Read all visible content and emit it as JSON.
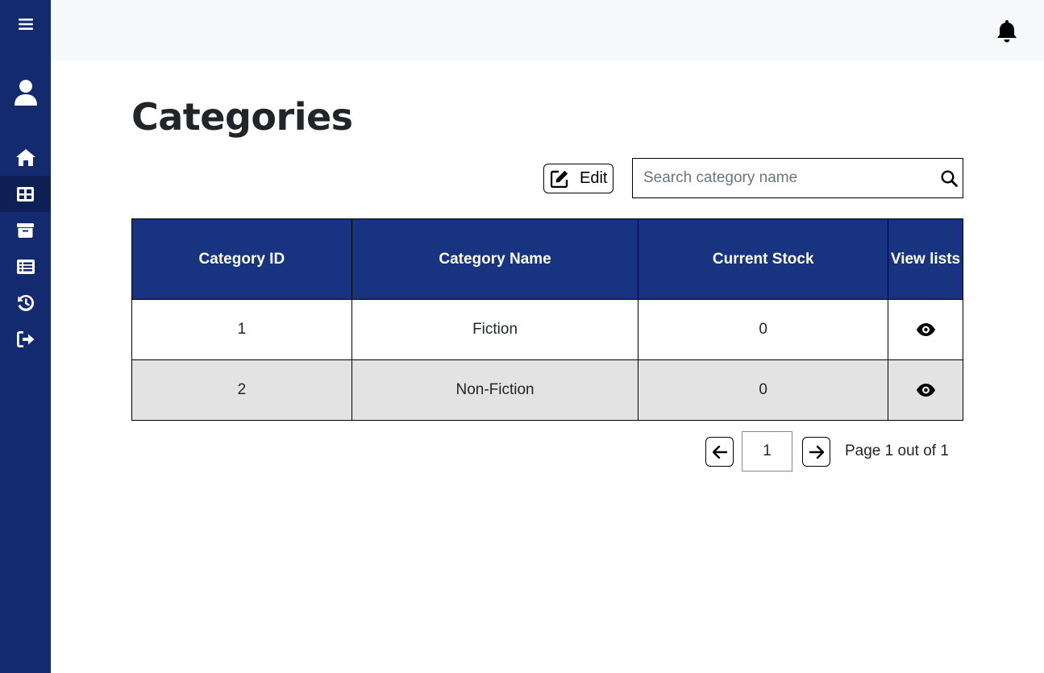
{
  "sidebar": {
    "items": [
      {
        "icon": "menu-icon"
      },
      {
        "icon": "user-icon"
      },
      {
        "icon": "home-icon"
      },
      {
        "icon": "table-icon",
        "active": true
      },
      {
        "icon": "archive-icon"
      },
      {
        "icon": "list-icon"
      },
      {
        "icon": "history-icon"
      },
      {
        "icon": "logout-icon"
      }
    ]
  },
  "topbar": {
    "icon": "bell-icon"
  },
  "page": {
    "title": "Categories"
  },
  "toolbar": {
    "edit_label": "Edit"
  },
  "search": {
    "placeholder": "Search category name",
    "value": ""
  },
  "table": {
    "headers": [
      "Category ID",
      "Category Name",
      "Current Stock",
      "View lists"
    ],
    "rows": [
      {
        "id": "1",
        "name": "Fiction",
        "stock": "0"
      },
      {
        "id": "2",
        "name": "Non-Fiction",
        "stock": "0"
      }
    ]
  },
  "pagination": {
    "current_page": "1",
    "status_text": "Page 1 out of 1"
  },
  "colors": {
    "sidebar": "#132b6e",
    "header": "#18337f",
    "alt_row": "#e3e3e3",
    "topbar": "#f8f9fa"
  }
}
